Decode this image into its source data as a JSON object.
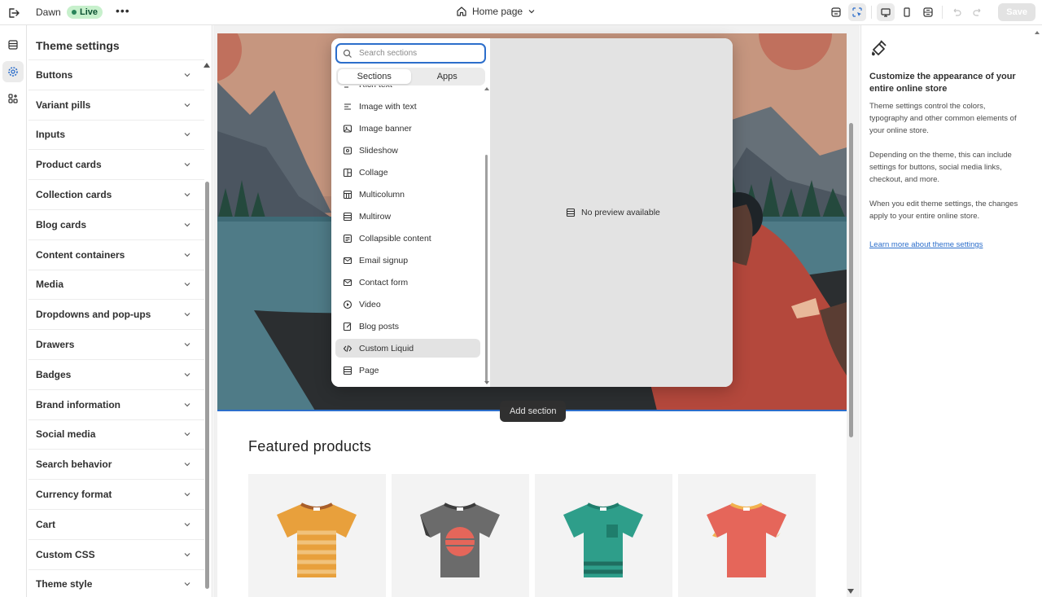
{
  "topbar": {
    "theme_name": "Dawn",
    "live_label": "Live",
    "page_label": "Home page",
    "save_label": "Save"
  },
  "panel": {
    "title": "Theme settings",
    "items": [
      "Buttons",
      "Variant pills",
      "Inputs",
      "Product cards",
      "Collection cards",
      "Blog cards",
      "Content containers",
      "Media",
      "Dropdowns and pop-ups",
      "Drawers",
      "Badges",
      "Brand information",
      "Social media",
      "Search behavior",
      "Currency format",
      "Cart",
      "Custom CSS",
      "Theme style"
    ]
  },
  "popover": {
    "search_placeholder": "Search sections",
    "tabs": [
      "Sections",
      "Apps"
    ],
    "active_tab": "Sections",
    "items": [
      {
        "label": "Rich text",
        "icon": "text-block-icon"
      },
      {
        "label": "Image with text",
        "icon": "image-text-icon"
      },
      {
        "label": "Image banner",
        "icon": "image-icon"
      },
      {
        "label": "Slideshow",
        "icon": "slideshow-icon"
      },
      {
        "label": "Collage",
        "icon": "collage-icon"
      },
      {
        "label": "Multicolumn",
        "icon": "multicolumn-icon"
      },
      {
        "label": "Multirow",
        "icon": "multirow-icon"
      },
      {
        "label": "Collapsible content",
        "icon": "collapsible-icon"
      },
      {
        "label": "Email signup",
        "icon": "email-icon"
      },
      {
        "label": "Contact form",
        "icon": "contact-form-icon"
      },
      {
        "label": "Video",
        "icon": "play-icon"
      },
      {
        "label": "Blog posts",
        "icon": "blog-icon"
      },
      {
        "label": "Custom Liquid",
        "icon": "code-icon"
      },
      {
        "label": "Page",
        "icon": "page-icon"
      }
    ],
    "highlighted": "Custom Liquid",
    "no_preview": "No preview available"
  },
  "preview": {
    "add_section_label": "Add section",
    "featured_title": "Featured products",
    "product_colors": [
      "#e8a03c",
      "#6b6b6b",
      "#2e9e8a",
      "#e5665a"
    ]
  },
  "help": {
    "title": "Customize the appearance of your entire online store",
    "p1": "Theme settings control the colors, typography and other common elements of your online store.",
    "p2": "Depending on the theme, this can include settings for buttons, social media links, checkout, and more.",
    "p3": "When you edit theme settings, the changes apply to your entire online store.",
    "link": "Learn more about theme settings"
  },
  "colors": {
    "accent": "#2c6ecb",
    "live_bg": "#c7f0cc",
    "live_dot": "#29845a"
  }
}
